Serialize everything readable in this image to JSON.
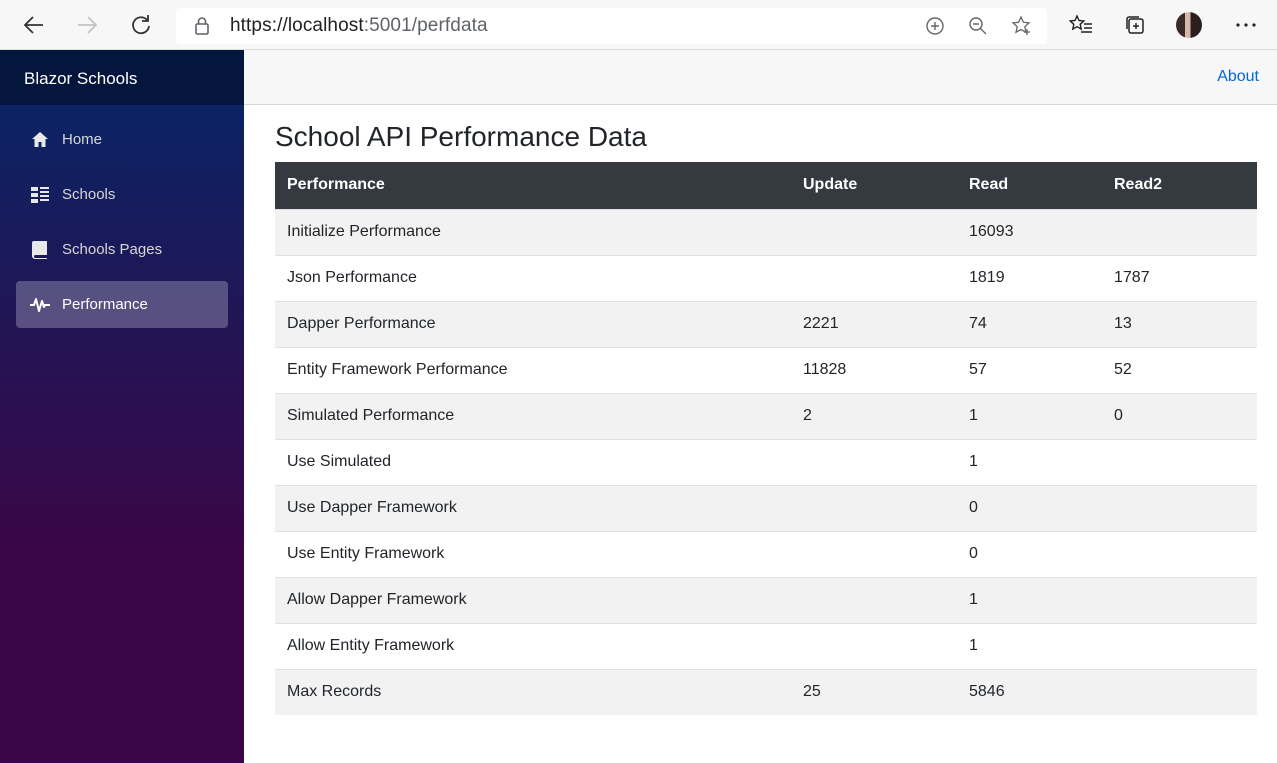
{
  "browser": {
    "url_host": "https://localhost",
    "url_rest": ":5001/perfdata"
  },
  "sidebar": {
    "brand": "Blazor Schools",
    "items": [
      {
        "label": "Home",
        "icon": "home-icon"
      },
      {
        "label": "Schools",
        "icon": "list-icon"
      },
      {
        "label": "Schools Pages",
        "icon": "book-icon"
      },
      {
        "label": "Performance",
        "icon": "pulse-icon",
        "active": true
      }
    ]
  },
  "topbar": {
    "about": "About"
  },
  "page": {
    "title": "School API Performance Data"
  },
  "table": {
    "headers": [
      "Performance",
      "Update",
      "Read",
      "Read2"
    ],
    "rows": [
      [
        "Initialize Performance",
        "",
        "16093",
        ""
      ],
      [
        "Json Performance",
        "",
        "1819",
        "1787"
      ],
      [
        "Dapper Performance",
        "2221",
        "74",
        "13"
      ],
      [
        "Entity Framework Performance",
        "11828",
        "57",
        "52"
      ],
      [
        "Simulated Performance",
        "2",
        "1",
        "0"
      ],
      [
        "Use Simulated",
        "",
        "1",
        ""
      ],
      [
        "Use Dapper Framework",
        "",
        "0",
        ""
      ],
      [
        "Use Entity Framework",
        "",
        "0",
        ""
      ],
      [
        "Allow Dapper Framework",
        "",
        "1",
        ""
      ],
      [
        "Allow Entity Framework",
        "",
        "1",
        ""
      ],
      [
        "Max Records",
        "25",
        "5846",
        ""
      ]
    ]
  }
}
